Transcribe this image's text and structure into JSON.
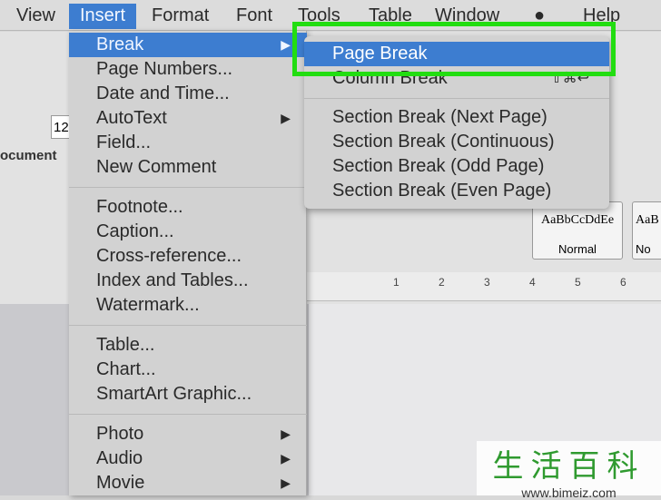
{
  "menubar": [
    "View",
    "Insert",
    "Format",
    "Font",
    "Tools",
    "Table",
    "Window",
    "Help"
  ],
  "toolbar": {
    "font_size": "12",
    "sidebar_label": "ocument",
    "styles": [
      "AaBbCcDdEe",
      "AaB"
    ],
    "style_names": [
      "Normal",
      "No"
    ],
    "ruler": [
      "1",
      "2",
      "3",
      "4",
      "5",
      "6"
    ]
  },
  "insert_menu": {
    "groups": [
      [
        {
          "label": "Break",
          "submenu": true,
          "highlighted": true
        },
        {
          "label": "Page Numbers..."
        },
        {
          "label": "Date and Time..."
        },
        {
          "label": "AutoText",
          "submenu": true
        },
        {
          "label": "Field..."
        },
        {
          "label": "New Comment"
        }
      ],
      [
        {
          "label": "Footnote..."
        },
        {
          "label": "Caption..."
        },
        {
          "label": "Cross-reference..."
        },
        {
          "label": "Index and Tables..."
        },
        {
          "label": "Watermark..."
        }
      ],
      [
        {
          "label": "Table..."
        },
        {
          "label": "Chart..."
        },
        {
          "label": "SmartArt Graphic..."
        }
      ],
      [
        {
          "label": "Photo",
          "submenu": true
        },
        {
          "label": "Audio",
          "submenu": true
        },
        {
          "label": "Movie",
          "submenu": true
        }
      ]
    ]
  },
  "break_submenu": [
    {
      "label": "Page Break",
      "highlighted": true
    },
    {
      "label": "Column Break",
      "shortcut": "⇧⌘↩"
    },
    {
      "label": "Section Break (Next Page)"
    },
    {
      "label": "Section Break (Continuous)"
    },
    {
      "label": "Section Break (Odd Page)"
    },
    {
      "label": "Section Break (Even Page)"
    }
  ],
  "watermark": {
    "title": "生活百科",
    "url": "www.bimeiz.com"
  },
  "colors": {
    "highlight": "#3d7dd0",
    "annotation": "#22dd11"
  }
}
